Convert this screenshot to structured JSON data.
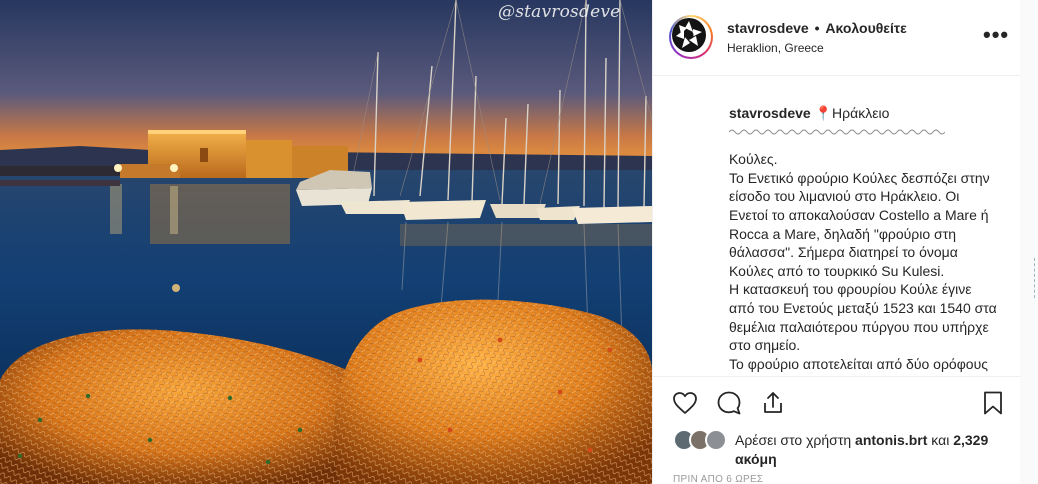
{
  "photo": {
    "watermark": "@stavrosdeve"
  },
  "header": {
    "username": "stavrosdeve",
    "separator": "•",
    "follow_state": "Ακολουθείτε",
    "location": "Heraklion, Greece",
    "more_label": "•••"
  },
  "caption": {
    "username": "stavrosdeve",
    "pin_glyph": "📍",
    "place": "Ηράκλειο",
    "lines": [
      "Κούλες.",
      "Το Ενετικό φρούριο Κούλες δεσπόζει στην είσοδο του λιμανιού στο Ηράκλειο. Οι Ενετοί το αποκαλούσαν Costello a Mare ή Rocca a Mare, δηλαδή \"φρούριο στη θάλασσα\". Σήμερα διατηρεί το όνομα Κούλες από το τουρκικό Su Kulesi.",
      "Η κατασκευή του φρουρίου Κούλε έγινε από του Ενετούς μεταξύ 1523 και 1540 στα θεμέλια παλαιότερου πύργου που υπήρχε στο σημείο.",
      "Το φρούριο αποτελείται από δύο ορόφους"
    ]
  },
  "actions": {
    "icons": [
      "heart-icon",
      "comment-icon",
      "share-icon",
      "bookmark-icon"
    ]
  },
  "likes": {
    "prefix": "Αρέσει στο χρήστη",
    "user": "antonis.brt",
    "conjunction": "και",
    "count": "2,329 ακόμη"
  },
  "timestamp": "ΠΡΙΝ ΑΠΟ 6 ΩΡΕΣ",
  "colors": {
    "accent_pin": "#ed4956",
    "text": "#262626",
    "muted": "#999999",
    "border": "#efefef"
  }
}
